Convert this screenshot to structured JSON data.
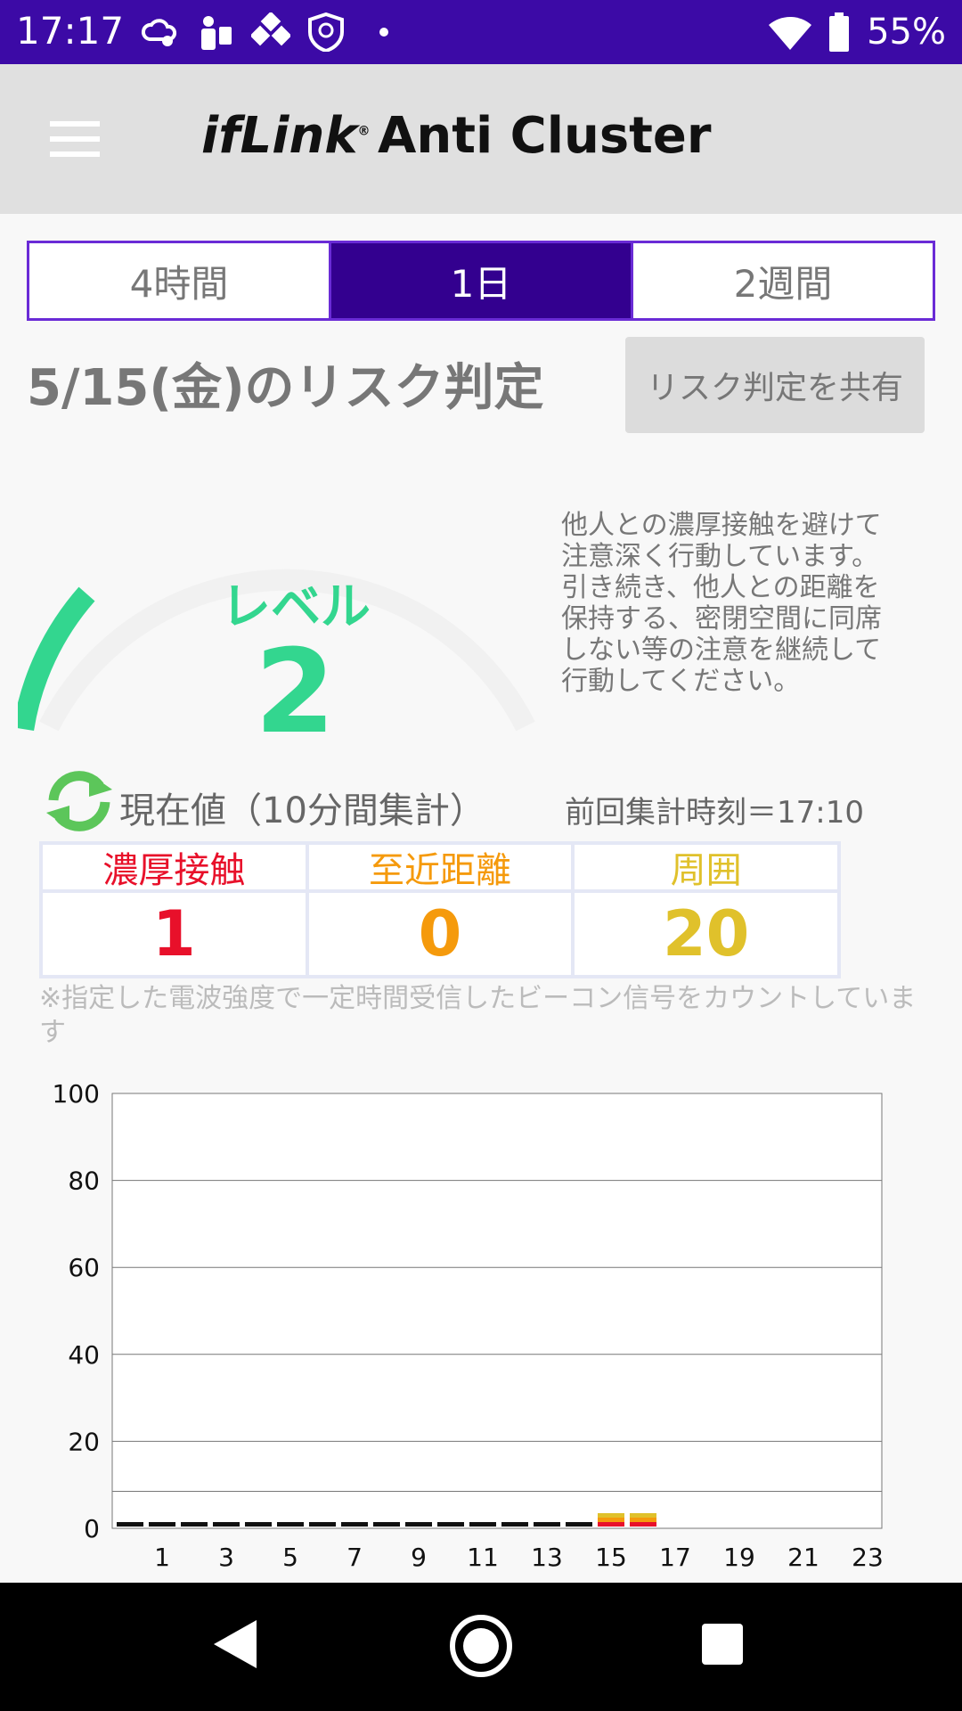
{
  "status_bar": {
    "time": "17:17",
    "battery": "55%",
    "icons": [
      "cloud-settings-icon",
      "bluetooth-speaker-icon",
      "cubes-icon",
      "shield-icon",
      "dot-icon",
      "wifi-icon",
      "battery-icon"
    ]
  },
  "app_bar": {
    "brand": "ifLink",
    "brand_mark": "®",
    "title": "Anti Cluster",
    "menu_icon": "hamburger-menu-icon"
  },
  "tabs": [
    {
      "label": "4時間",
      "active": false
    },
    {
      "label": "1日",
      "active": true
    },
    {
      "label": "2週間",
      "active": false
    }
  ],
  "risk": {
    "title": "5/15(金)のリスク判定",
    "share_label": "リスク判定を共有",
    "level_label": "レベル",
    "level_value": "2",
    "level_fraction": 0.2,
    "level_color": "#33d68f",
    "advice": "他人との濃厚接触を避けて注意深く行動しています。引き続き、他人との距離を保持する、密閉空間に同席しない等の注意を継続して行動してください。"
  },
  "current": {
    "label": "現在値（10分間集計）",
    "prev_time": "前回集計時刻＝17:10",
    "icon": "refresh-icon",
    "stats": [
      {
        "label": "濃厚接触",
        "value": "1",
        "color": "#e8102a"
      },
      {
        "label": "至近距離",
        "value": "0",
        "color": "#f59a0c"
      },
      {
        "label": "周囲",
        "value": "20",
        "color": "#e0c12b"
      }
    ],
    "note": "※指定した電波強度で一定時間受信したビーコン信号をカウントしています"
  },
  "chart_data": {
    "type": "bar",
    "stacked": true,
    "ylim": [
      0,
      100
    ],
    "yticks": [
      0,
      20,
      40,
      60,
      80,
      100
    ],
    "xticks": [
      "1",
      "3",
      "5",
      "7",
      "9",
      "11",
      "13",
      "15",
      "17",
      "19",
      "21",
      "23"
    ],
    "categories": [
      "0",
      "1",
      "2",
      "3",
      "4",
      "5",
      "6",
      "7",
      "8",
      "9",
      "10",
      "11",
      "12",
      "13",
      "14",
      "15",
      "16",
      "17",
      "18",
      "19",
      "20",
      "21",
      "22",
      "23"
    ],
    "series": [
      {
        "color": "#111111",
        "values": [
          1,
          1,
          1,
          1,
          1,
          1,
          1,
          1,
          1,
          1,
          1,
          1,
          1,
          1,
          1,
          0,
          0,
          0,
          0,
          0,
          0,
          0,
          0,
          0
        ]
      },
      {
        "color": "#e8102a",
        "values": [
          0,
          0,
          0,
          0,
          0,
          0,
          0,
          0,
          0,
          0,
          0,
          0,
          0,
          0,
          0,
          1,
          1,
          0,
          0,
          0,
          0,
          0,
          0,
          0
        ]
      },
      {
        "color": "#f59a0c",
        "values": [
          0,
          0,
          0,
          0,
          0,
          0,
          0,
          0,
          0,
          0,
          0,
          0,
          0,
          0,
          0,
          1,
          1,
          0,
          0,
          0,
          0,
          0,
          0,
          0
        ]
      },
      {
        "color": "#e0c12b",
        "values": [
          0,
          0,
          0,
          0,
          0,
          0,
          0,
          0,
          0,
          0,
          0,
          0,
          0,
          0,
          0,
          1,
          1,
          0,
          0,
          0,
          0,
          0,
          0,
          0
        ]
      }
    ],
    "reference_line": 8.5,
    "grid": true
  }
}
